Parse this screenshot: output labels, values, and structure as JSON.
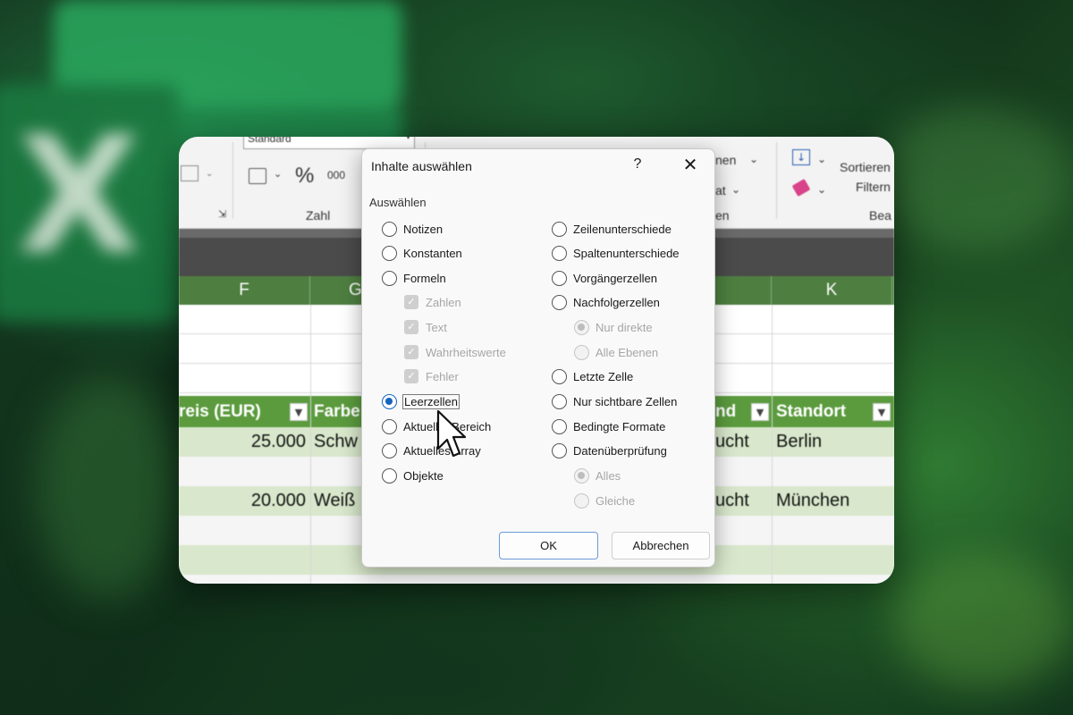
{
  "ribbon": {
    "number_format": "Standard",
    "percent": "%",
    "thousands": "000",
    "group_number": "Zahl",
    "frag_nen": "nen",
    "frag_at": "at",
    "frag_en": "en",
    "sort_line1": "Sortieren",
    "sort_line2": "Filtern",
    "frag_bea": "Bea"
  },
  "columns": [
    "F",
    "G",
    "K"
  ],
  "table": {
    "headers": [
      "reis (EUR)",
      "Farbe",
      "nd",
      "Standort"
    ],
    "rows": [
      {
        "price": "25.000",
        "color": "Schw",
        "frag": "ucht",
        "location": "Berlin"
      },
      {
        "price": "20.000",
        "color": "Weiß",
        "frag": "ucht",
        "location": "München"
      }
    ]
  },
  "dialog": {
    "title": "Inhalte auswählen",
    "help": "?",
    "close": "✕",
    "group": "Auswählen",
    "left_options": [
      {
        "label": "Notizen",
        "selected": false
      },
      {
        "label": "Konstanten",
        "selected": false
      },
      {
        "label": "Formeln",
        "selected": false
      },
      {
        "label": "Zahlen",
        "sub": true
      },
      {
        "label": "Text",
        "sub": true
      },
      {
        "label": "Wahrheitswerte",
        "sub": true
      },
      {
        "label": "Fehler",
        "sub": true
      },
      {
        "label": "Leerzellen",
        "selected": true
      },
      {
        "label": "Aktueller Bereich",
        "selected": false
      },
      {
        "label": "Aktuelles Array",
        "selected": false
      },
      {
        "label": "Objekte",
        "selected": false
      }
    ],
    "right_options": [
      {
        "label": "Zeilenunterschiede"
      },
      {
        "label": "Spaltenunterschiede"
      },
      {
        "label": "Vorgängerzellen"
      },
      {
        "label": "Nachfolgerzellen"
      },
      {
        "label": "Nur direkte",
        "sub": true,
        "selected": true
      },
      {
        "label": "Alle Ebenen",
        "sub": true
      },
      {
        "label": "Letzte Zelle"
      },
      {
        "label": "Nur sichtbare Zellen"
      },
      {
        "label": "Bedingte Formate"
      },
      {
        "label": "Datenüberprüfung"
      },
      {
        "label": "Alles",
        "sub": true,
        "selected": true
      },
      {
        "label": "Gleiche",
        "sub": true
      }
    ],
    "ok": "OK",
    "cancel": "Abbrechen"
  },
  "colors": {
    "accent": "#1565c0",
    "table_header": "#5b9b3e",
    "column_header": "#4e7f40"
  }
}
